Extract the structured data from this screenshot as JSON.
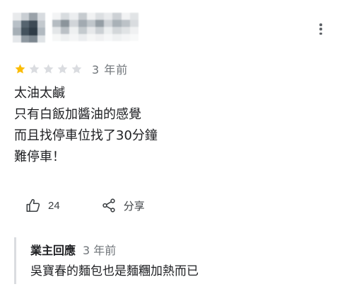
{
  "reviewer": {
    "avatar_colors": [
      "#e8eaec",
      "#c9ced3",
      "#9aa2a9",
      "#d7dbdf",
      "#b8c0c7",
      "#56646f",
      "#3d4a55",
      "#c3c9ce",
      "#a6afb6",
      "#44525d",
      "#2f3c47",
      "#b1b9c0",
      "#e4e7ea",
      "#8e98a0",
      "#7c8790",
      "#dfe3e6"
    ],
    "name_blur_colors": [
      "#f3f4f5",
      "#d8dcdf",
      "#eceef0",
      "#c6cbcf",
      "#f1f2f3",
      "#dcdfe2",
      "#e9ebed",
      "#cdd1d5",
      "#f2f3f4",
      "#e1e4e6",
      "#b5bcc2",
      "#8b949b",
      "#d1d5d9",
      "#a2aab1",
      "#c0c6cb",
      "#959ea5",
      "#cfd3d7",
      "#a9b1b7",
      "#bcc2c7",
      "#d9dcdf",
      "#e3e6e8",
      "#bac0c5",
      "#eef0f1",
      "#c4cace",
      "#e6e8ea",
      "#cbd0d4",
      "#eceff0",
      "#d3d7da",
      "#e0e3e5",
      "#f0f1f2",
      "#f6f7f7",
      "#eef0f1",
      "#f4f5f6",
      "#ebedef",
      "#f5f6f6",
      "#f0f1f2",
      "#f6f7f8",
      "#eff1f2",
      "#f4f5f6",
      "#f8f9f9"
    ]
  },
  "more_options_icon": "more-vert-icon",
  "rating": {
    "stars": 1,
    "max_stars": 5,
    "filled_color": "#fbbc04",
    "empty_color": "#dadce0",
    "time_ago": "3 年前"
  },
  "review": {
    "lines": [
      "太油太鹹",
      "只有白飯加醬油的感覺",
      "而且找停車位找了30分鐘",
      "難停車！"
    ]
  },
  "actions": {
    "like_icon": "thumb-up-icon",
    "like_count": "24",
    "share_icon": "share-icon",
    "share_label": "分享"
  },
  "owner_reply": {
    "owner_label": "業主回應",
    "time_ago": "3 年前",
    "text": "吳寶春的麵包也是麵糰加熱而已"
  }
}
